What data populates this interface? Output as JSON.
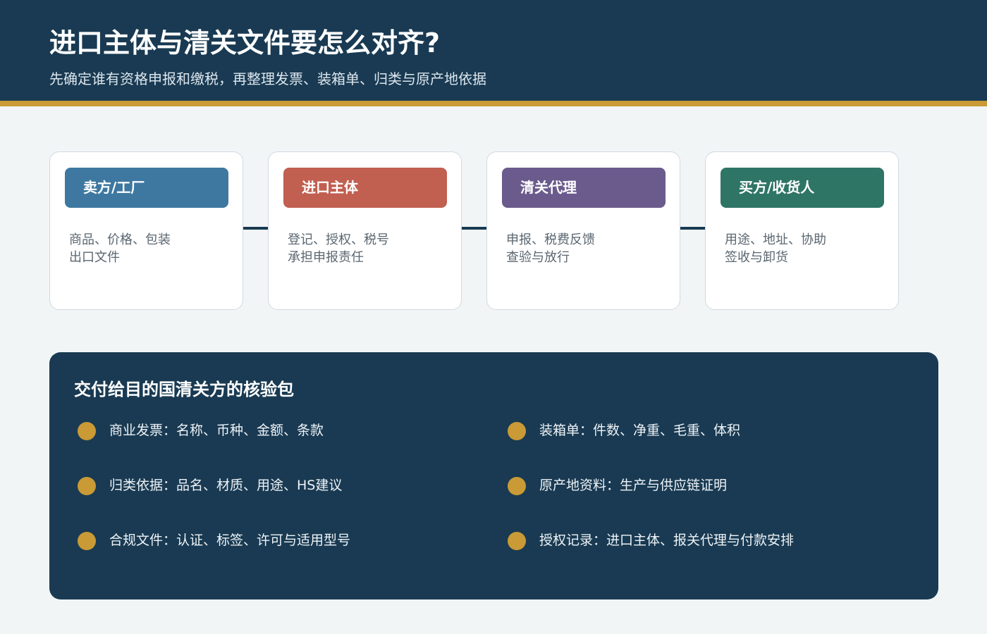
{
  "header": {
    "title": "进口主体与清关文件要怎么对齐?",
    "subtitle": "先确定谁有资格申报和缴税，再整理发票、装箱单、归类与原产地依据"
  },
  "flow": [
    {
      "label": "卖方/工厂",
      "color": "#3e78a0",
      "lines": [
        "商品、价格、包装",
        "出口文件"
      ]
    },
    {
      "label": "进口主体",
      "color": "#c15f50",
      "lines": [
        "登记、授权、税号",
        "承担申报责任"
      ]
    },
    {
      "label": "清关代理",
      "color": "#6b5b8c",
      "lines": [
        "申报、税费反馈",
        "查验与放行"
      ]
    },
    {
      "label": "买方/收货人",
      "color": "#2e7566",
      "lines": [
        "用途、地址、协助",
        "签收与卸货"
      ]
    }
  ],
  "panel": {
    "title": "交付给目的国清关方的核验包",
    "items": [
      "商业发票：名称、币种、金额、条款",
      "装箱单：件数、净重、毛重、体积",
      "归类依据：品名、材质、用途、HS建议",
      "原产地资料：生产与供应链证明",
      "合规文件：认证、标签、许可与适用型号",
      "授权记录：进口主体、报关代理与付款安排"
    ]
  },
  "colors": {
    "header_bg": "#193a52",
    "accent": "#c99a35",
    "page_bg": "#f2f5f6"
  }
}
